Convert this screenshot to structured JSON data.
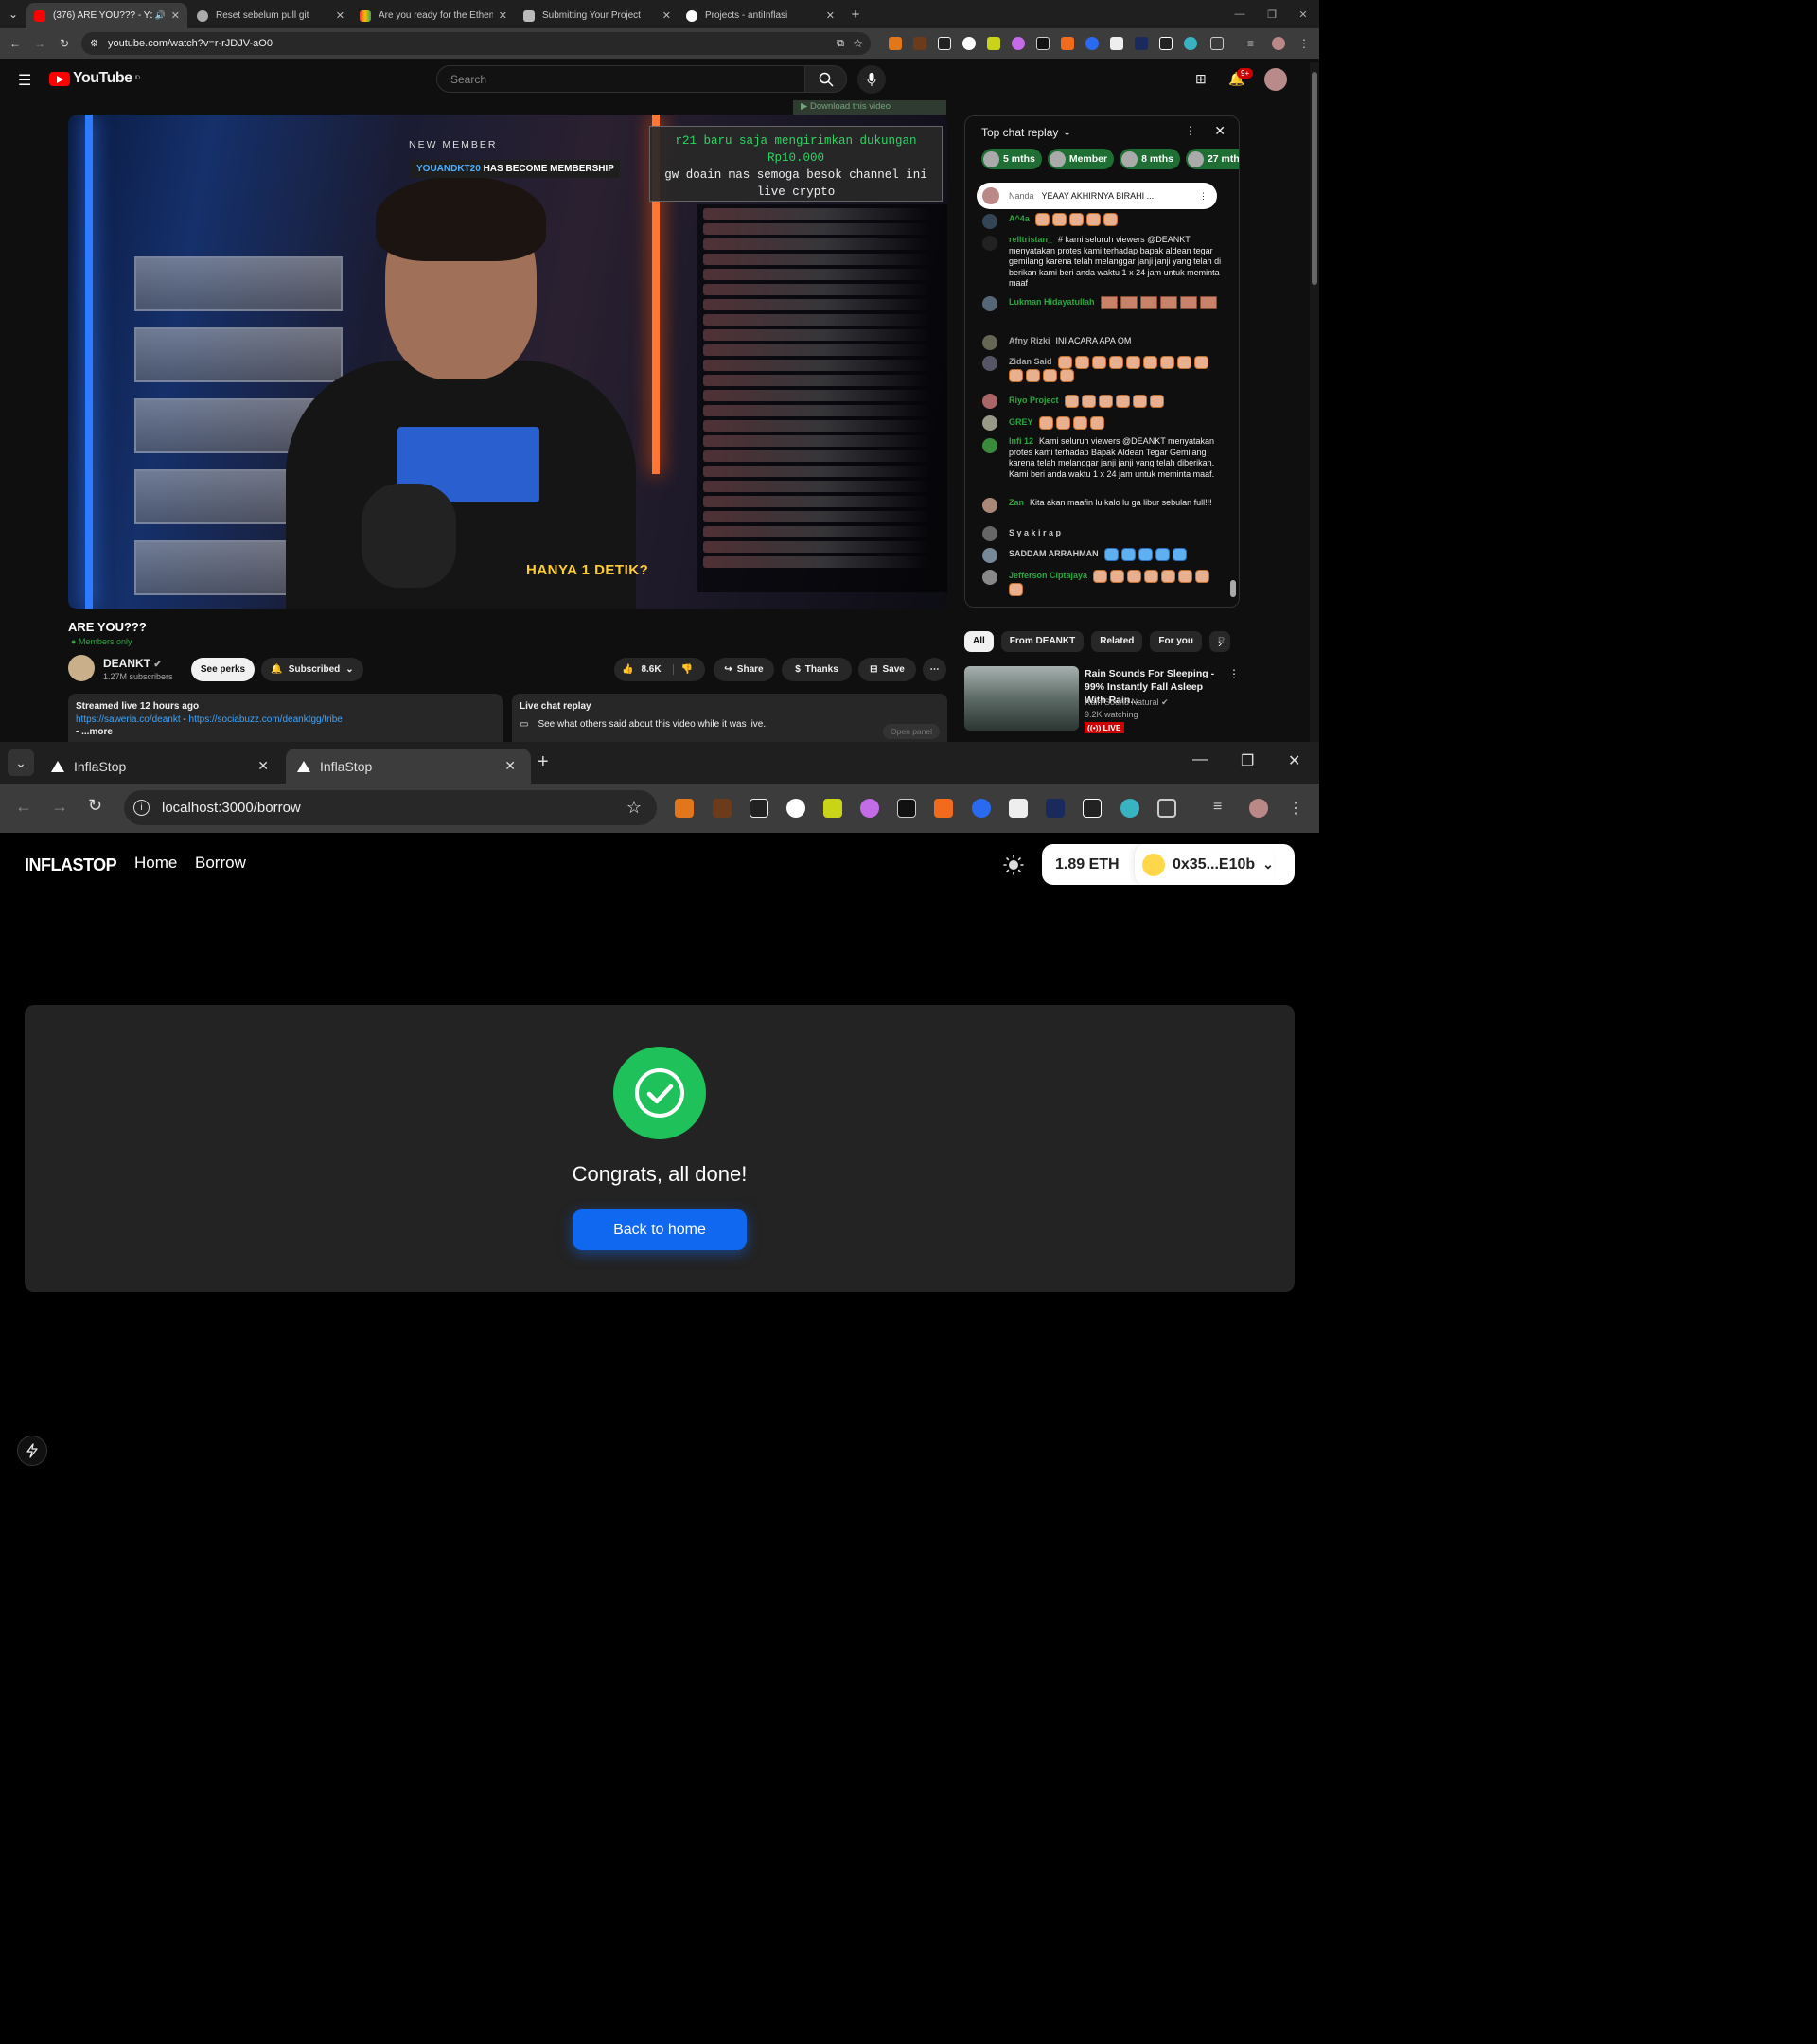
{
  "top_window": {
    "tabs": [
      {
        "title": "(376) ARE YOU??? - YouTube",
        "active": true
      },
      {
        "title": "Reset sebelum pull git"
      },
      {
        "title": "Are you ready for the Ethena H..."
      },
      {
        "title": "Submitting Your Project"
      },
      {
        "title": "Projects - antiInflasi"
      }
    ],
    "url": "youtube.com/watch?v=r-rJDJV-aO0",
    "youtube": {
      "logo": "YouTube",
      "region": "ID",
      "search_placeholder": "Search",
      "notif_count": "9+",
      "download_bar": "Download this video",
      "video": {
        "new_member_label": "NEW MEMBER",
        "new_member_name": "YOUANDKT20",
        "new_member_text": "HAS BECOME MEMBERSHIP",
        "donation_line1": "r21 baru saja mengirimkan dukungan",
        "donation_amount": "Rp10.000",
        "donation_line2": "gw doain mas semoga besok channel ini",
        "donation_line3": "live crypto",
        "caption": "HANYA 1 DETIK?"
      },
      "title": "ARE YOU???",
      "members_only": "Members only",
      "channel": "DEANKT",
      "subscribers": "1.27M subscribers",
      "see_perks": "See perks",
      "subscribed": "Subscribed",
      "likes": "8.6K",
      "share": "Share",
      "thanks": "Thanks",
      "save": "Save",
      "description": {
        "streamed": "Streamed live 12 hours ago",
        "link1": "https://saweria.co/deankt",
        "sep": " - ",
        "link2": "https://sociabuzz.com/deanktgg/tribe",
        "more": "- ...more"
      },
      "live_chat_box": {
        "title": "Live chat replay",
        "text": "See what others said about this video while it was live.",
        "open_panel": "Open panel"
      },
      "chat": {
        "header": "Top chat replay",
        "chips": [
          "5 mths",
          "Member",
          "8 mths",
          "27 mths"
        ],
        "pinned_author": "Nanda",
        "pinned_text": "YEAAY AKHIRNYA BIRAHI ...",
        "messages": [
          {
            "author": "A^4a",
            "text": ""
          },
          {
            "author": "relltristan_",
            "text": "# kami seluruh viewers @DEANKT menyatakan protes kami terhadap bapak aldean tegar gemilang karena telah melanggar janji janji yang telah di berikan kami beri anda waktu 1 x 24 jam untuk meminta maaf"
          },
          {
            "author": "Lukman Hidayatullah",
            "text": ""
          },
          {
            "author": "Afny Rizki",
            "text": "INI ACARA APA OM"
          },
          {
            "author": "Zidan Said",
            "text": ""
          },
          {
            "author": "Riyo Project",
            "text": ""
          },
          {
            "author": "GREY",
            "text": ""
          },
          {
            "author": "Infi 12",
            "text": "Kami seluruh viewers @DEANKT menyatakan protes kami terhadap Bapak Aldean Tegar Gemilang karena telah melanggar janji janji yang telah diberikan. Kami beri anda waktu 1 x 24 jam untuk meminta maaf."
          },
          {
            "author": "Zan",
            "text": "Kita akan maafin lu kalo lu ga libur sebulan full!!!"
          },
          {
            "author": "S y a k i r a  p",
            "text": ""
          },
          {
            "author": "SADDAM ARRAHMAN",
            "text": ""
          },
          {
            "author": "Jefferson Ciptajaya",
            "text": ""
          }
        ]
      },
      "filters": [
        "All",
        "From DEANKT",
        "Related",
        "For you",
        "R"
      ],
      "recommendation": {
        "title": "Rain Sounds For Sleeping - 99% Instantly Fall Asleep With Rain...",
        "channel": "Rain Sound Natural",
        "watching": "9.2K watching",
        "live": "LIVE"
      }
    }
  },
  "bottom_window": {
    "tabs": [
      {
        "title": "InflaStop"
      },
      {
        "title": "InflaStop",
        "active": true
      }
    ],
    "url": "localhost:3000/borrow",
    "app": {
      "brand": "INFLASTOP",
      "nav": [
        "Home",
        "Borrow"
      ],
      "balance": "1.89 ETH",
      "account": "0x35...E10b",
      "success_message": "Congrats, all done!",
      "back_button": "Back to home",
      "accent": "#1168f0",
      "success_color": "#1fc25a"
    }
  }
}
